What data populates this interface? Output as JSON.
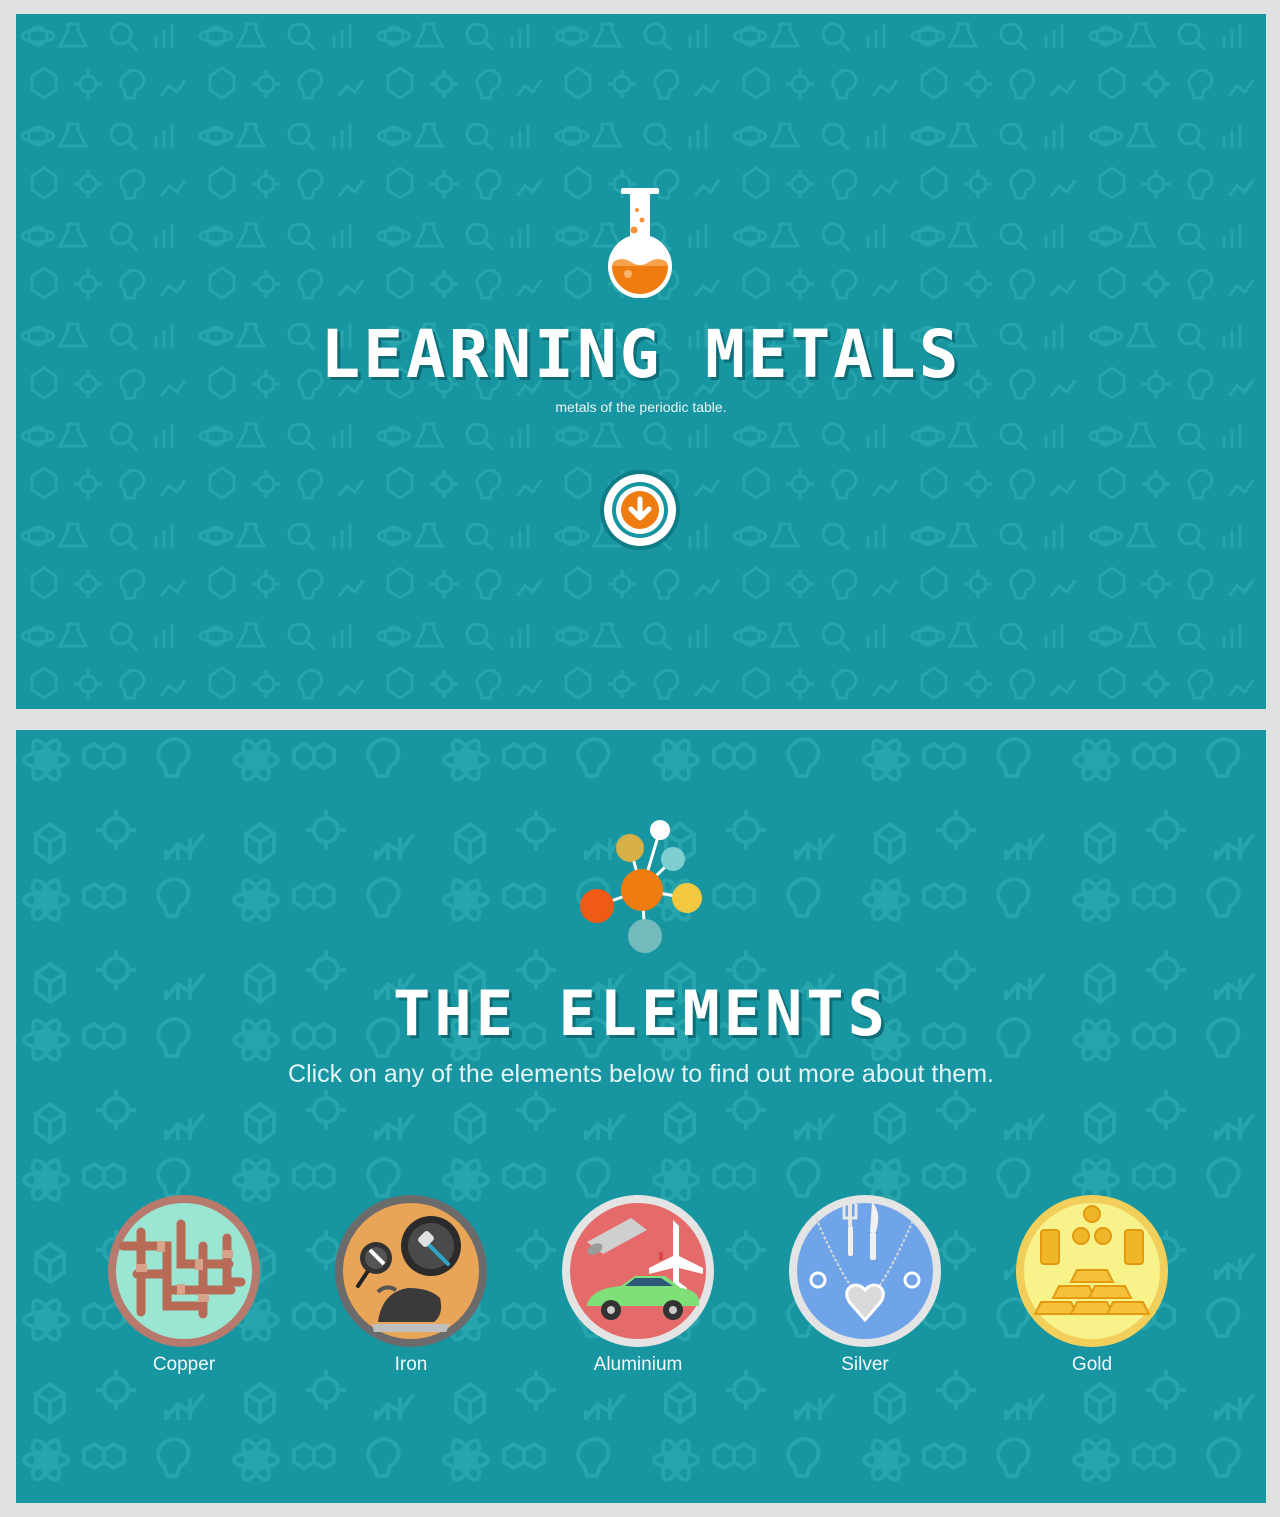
{
  "hero": {
    "title": "LEARNING METALS",
    "subtitle": "metals of the periodic table.",
    "icons": {
      "flask": "flask-icon",
      "scroll": "arrow-down-circle-icon"
    }
  },
  "elements_section": {
    "title": "THE ELEMENTS",
    "subtitle": "Click on any of the elements below to find out more about them.",
    "icon": "molecule-icon",
    "items": [
      {
        "name": "Copper",
        "icon": "copper-pipes-icon",
        "ring": "#b97a6e",
        "fill": "#9be6d3"
      },
      {
        "name": "Iron",
        "icon": "iron-cookware-icon",
        "ring": "#6b6b6b",
        "fill": "#e8a457"
      },
      {
        "name": "Aluminium",
        "icon": "aluminium-vehicles-icon",
        "ring": "#e4e4e4",
        "fill": "#e56b6b"
      },
      {
        "name": "Silver",
        "icon": "silver-jewelry-icon",
        "ring": "#e4e4e4",
        "fill": "#6fa5e8"
      },
      {
        "name": "Gold",
        "icon": "gold-bars-icon",
        "ring": "#f2cf5a",
        "fill": "#f7f28a"
      }
    ]
  },
  "colors": {
    "page_background": "#e1e1e1",
    "panel_background": "#1795a0",
    "accent_orange": "#ee7c10",
    "text": "#ffffff"
  }
}
